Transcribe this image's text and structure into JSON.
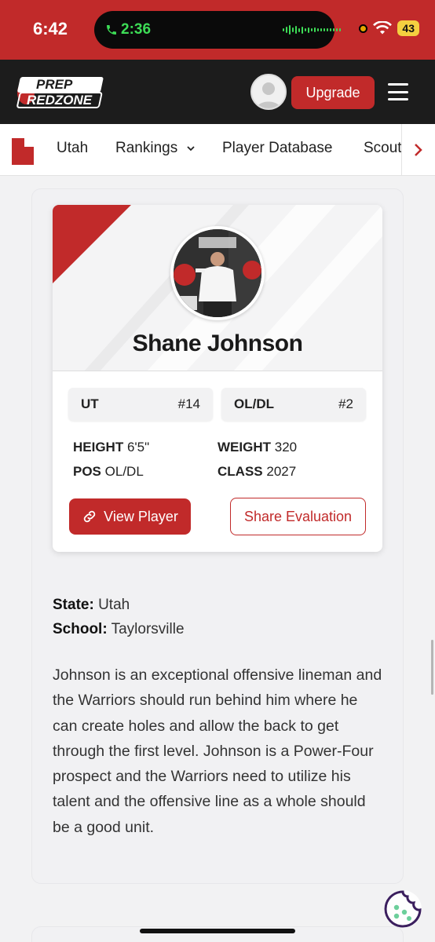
{
  "status_bar": {
    "time": "6:42",
    "call_timer": "2:36",
    "battery": "43"
  },
  "header": {
    "logo_top": "PREP",
    "logo_bottom": "REDZONE",
    "upgrade_label": "Upgrade"
  },
  "subnav": {
    "items": [
      "Utah",
      "Rankings",
      "Player Database",
      "Scouting"
    ]
  },
  "player": {
    "name": "Shane Johnson",
    "state_chip": {
      "label": "UT",
      "rank": "#14"
    },
    "position_chip": {
      "label": "OL/DL",
      "rank": "#2"
    },
    "height_label": "HEIGHT",
    "height": "6'5\"",
    "weight_label": "WEIGHT",
    "weight": "320",
    "pos_label": "POS",
    "pos": "OL/DL",
    "class_label": "CLASS",
    "class": "2027",
    "view_label": "View Player",
    "share_label": "Share Evaluation"
  },
  "details": {
    "state_label": "State:",
    "state": "Utah",
    "school_label": "School:",
    "school": "Taylorsville",
    "description": "Johnson is an exceptional offensive lineman and the Warriors should run behind him where he can create holes and allow the back to get through the first level. Johnson is a Power-Four prospect and the Warriors need to utilize his talent and the offensive line as a whole should be a good unit."
  },
  "colors": {
    "brand_red": "#c12a2a",
    "header_dark": "#1c1c1c"
  },
  "icons": [
    "phone-icon",
    "wifi-icon",
    "chevron-down-icon",
    "chevron-right-icon",
    "link-icon",
    "cookie-icon",
    "menu-icon",
    "user-avatar-icon",
    "utah-state-icon"
  ]
}
